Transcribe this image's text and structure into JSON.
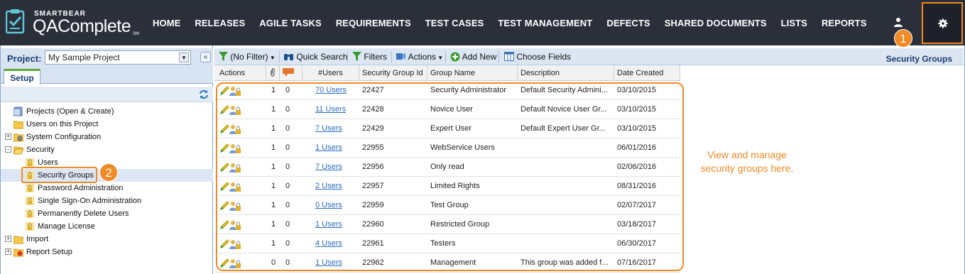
{
  "brand": {
    "company": "SMARTBEAR",
    "product": "QAComplete",
    "suffix": "SM"
  },
  "nav": [
    "HOME",
    "RELEASES",
    "AGILE TASKS",
    "REQUIREMENTS",
    "TEST CASES",
    "TEST MANAGEMENT",
    "DEFECTS",
    "SHARED DOCUMENTS",
    "LISTS",
    "REPORTS"
  ],
  "callouts": {
    "one": "1",
    "two": "2"
  },
  "project": {
    "label": "Project:",
    "value": "My Sample Project"
  },
  "tab": "Setup",
  "tree": [
    {
      "label": "Projects (Open & Create)",
      "icon": "projects-icon",
      "level": 0,
      "expander": ""
    },
    {
      "label": "Users on this Project",
      "icon": "folder-icon",
      "level": 0,
      "expander": ""
    },
    {
      "label": "System Configuration",
      "icon": "config-icon",
      "level": 0,
      "expander": "+"
    },
    {
      "label": "Security",
      "icon": "folder-open-icon",
      "level": 0,
      "expander": "-"
    },
    {
      "label": "Users",
      "icon": "lock-icon",
      "level": 1,
      "expander": ""
    },
    {
      "label": "Security Groups",
      "icon": "lock-icon",
      "level": 1,
      "expander": ""
    },
    {
      "label": "Password Administration",
      "icon": "lock-icon",
      "level": 1,
      "expander": ""
    },
    {
      "label": "Single Sign-On Administration",
      "icon": "lock-icon",
      "level": 1,
      "expander": ""
    },
    {
      "label": "Permanently Delete Users",
      "icon": "lock-icon",
      "level": 1,
      "expander": ""
    },
    {
      "label": "Manage License",
      "icon": "lock-icon",
      "level": 1,
      "expander": ""
    },
    {
      "label": "Import",
      "icon": "folder-icon",
      "level": 0,
      "expander": "+"
    },
    {
      "label": "Report Setup",
      "icon": "report-icon",
      "level": 0,
      "expander": "+"
    }
  ],
  "toolbar": {
    "filter": "(No Filter)",
    "quick_search": "Quick Search",
    "filters": "Filters",
    "actions": "Actions",
    "add_new": "Add New",
    "choose_fields": "Choose Fields",
    "section_title": "Security Groups"
  },
  "grid": {
    "headers": [
      "Actions",
      "",
      "",
      "#Users",
      "Security Group Id",
      "Group Name",
      "Description",
      "Date Created"
    ],
    "rows": [
      {
        "attach": "1",
        "notes": "0",
        "users": "70 Users",
        "id": "22427",
        "name": "Security Administrator",
        "desc": "Default Security Admini...",
        "date": "03/10/2015"
      },
      {
        "attach": "1",
        "notes": "0",
        "users": "11 Users",
        "id": "22428",
        "name": "Novice User",
        "desc": "Default Novice User Gr...",
        "date": "03/10/2015"
      },
      {
        "attach": "1",
        "notes": "0",
        "users": "7 Users",
        "id": "22429",
        "name": "Expert User",
        "desc": "Default Expert User Gr...",
        "date": "03/10/2015"
      },
      {
        "attach": "1",
        "notes": "0",
        "users": "1 Users",
        "id": "22955",
        "name": "WebService Users",
        "desc": "",
        "date": "06/01/2016"
      },
      {
        "attach": "1",
        "notes": "0",
        "users": "7 Users",
        "id": "22956",
        "name": "Only read",
        "desc": "",
        "date": "02/06/2016"
      },
      {
        "attach": "1",
        "notes": "0",
        "users": "2 Users",
        "id": "22957",
        "name": "Limited Rights",
        "desc": "",
        "date": "08/31/2016"
      },
      {
        "attach": "1",
        "notes": "0",
        "users": "0 Users",
        "id": "22959",
        "name": "Test Group",
        "desc": "",
        "date": "02/07/2017"
      },
      {
        "attach": "1",
        "notes": "0",
        "users": "1 Users",
        "id": "22960",
        "name": "Restricted Group",
        "desc": "",
        "date": "03/18/2017"
      },
      {
        "attach": "1",
        "notes": "0",
        "users": "4 Users",
        "id": "22961",
        "name": "Testers",
        "desc": "",
        "date": "06/30/2017"
      },
      {
        "attach": "0",
        "notes": "0",
        "users": "1 Users",
        "id": "22962",
        "name": "Management",
        "desc": "This group was added f...",
        "date": "07/16/2017"
      }
    ]
  },
  "note": "View and manage security groups here.",
  "colors": {
    "accent": "#f08a24",
    "nav_bg": "#2b2f3a",
    "link": "#2a6cc2",
    "header_blue": "#1b3b73"
  }
}
